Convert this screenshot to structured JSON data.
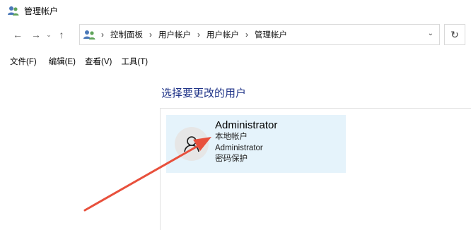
{
  "window": {
    "title": "管理帐户",
    "title_icon": "users-icon"
  },
  "navigation": {
    "back_icon": "arrow-left-icon",
    "forward_icon": "arrow-right-icon",
    "recent_icon": "chevron-down-icon",
    "up_icon": "arrow-up-icon",
    "breadcrumbs": [
      "控制面板",
      "用户帐户",
      "用户帐户",
      "管理帐户"
    ],
    "dropdown_icon": "chevron-down-icon",
    "refresh_icon": "refresh-icon"
  },
  "menu": {
    "items": [
      "文件(F)",
      "编辑(E)",
      "查看(V)",
      "工具(T)"
    ]
  },
  "content": {
    "heading": "选择要更改的用户",
    "accounts": [
      {
        "name": "Administrator",
        "type": "本地帐户",
        "group": "Administrator",
        "protection": "密码保护",
        "avatar_icon": "user-icon"
      }
    ]
  },
  "annotation": {
    "arrow_color": "#e8503c"
  },
  "colors": {
    "heading": "#1e3287",
    "tile_selected": "#e5f3fb"
  }
}
